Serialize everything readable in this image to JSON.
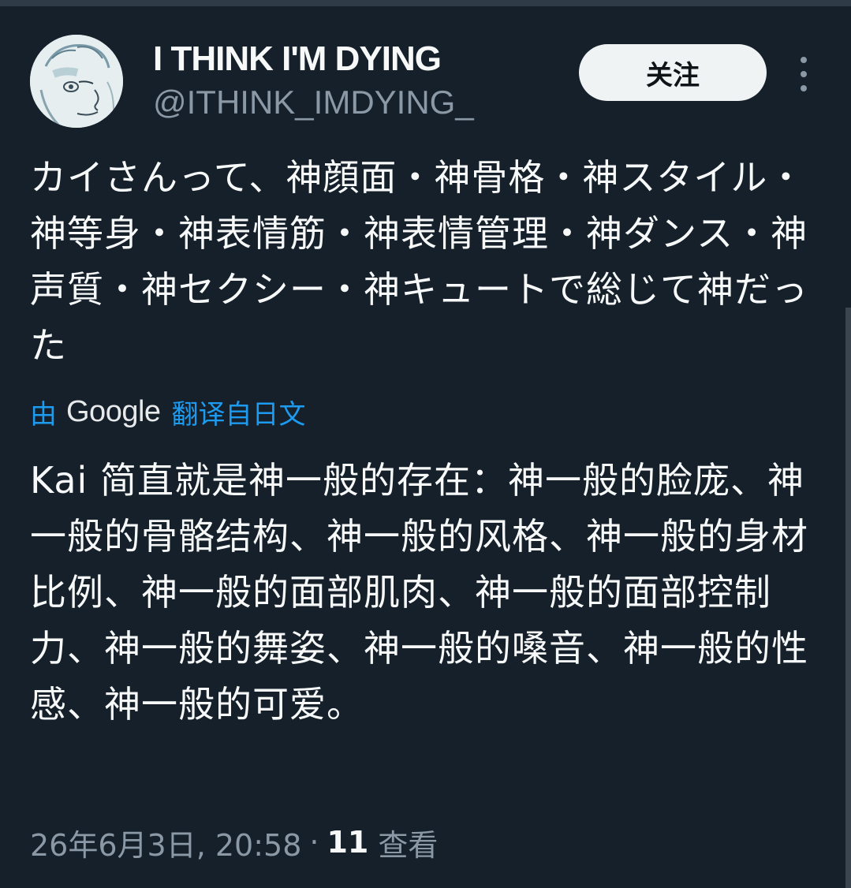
{
  "user": {
    "display_name": "I THINK I'M DYING",
    "handle": "@ITHINK_IMDYING_",
    "follow_label": "关注",
    "avatar_icon": "sketch-portrait-avatar",
    "more_icon": "more-vertical-icon"
  },
  "tweet": {
    "original_text": "カイさんって、神顔面・神骨格・神スタイル・神等身・神表情筋・神表情管理・神ダンス・神声質・神セクシー・神キュートで総じて神だった",
    "translation": {
      "prefix": "由",
      "provider": "Google",
      "link_label": "翻译自日文"
    },
    "translated_text": "Kai 简直就是神一般的存在：神一般的脸庞、神一般的骨骼结构、神一般的风格、神一般的身材比例、神一般的面部肌肉、神一般的面部控制力、神一般的舞姿、神一般的嗓音、神一般的性感、神一般的可爱。"
  },
  "meta": {
    "timestamp": "26年6月3日, 20:58",
    "separator": "·",
    "views_count": "11",
    "views_label": "查看"
  },
  "colors": {
    "background": "#15202b",
    "text_primary": "#f7f9f9",
    "text_secondary": "#8b98a5",
    "accent": "#1d9bf0",
    "button_bg": "#eff3f4"
  }
}
